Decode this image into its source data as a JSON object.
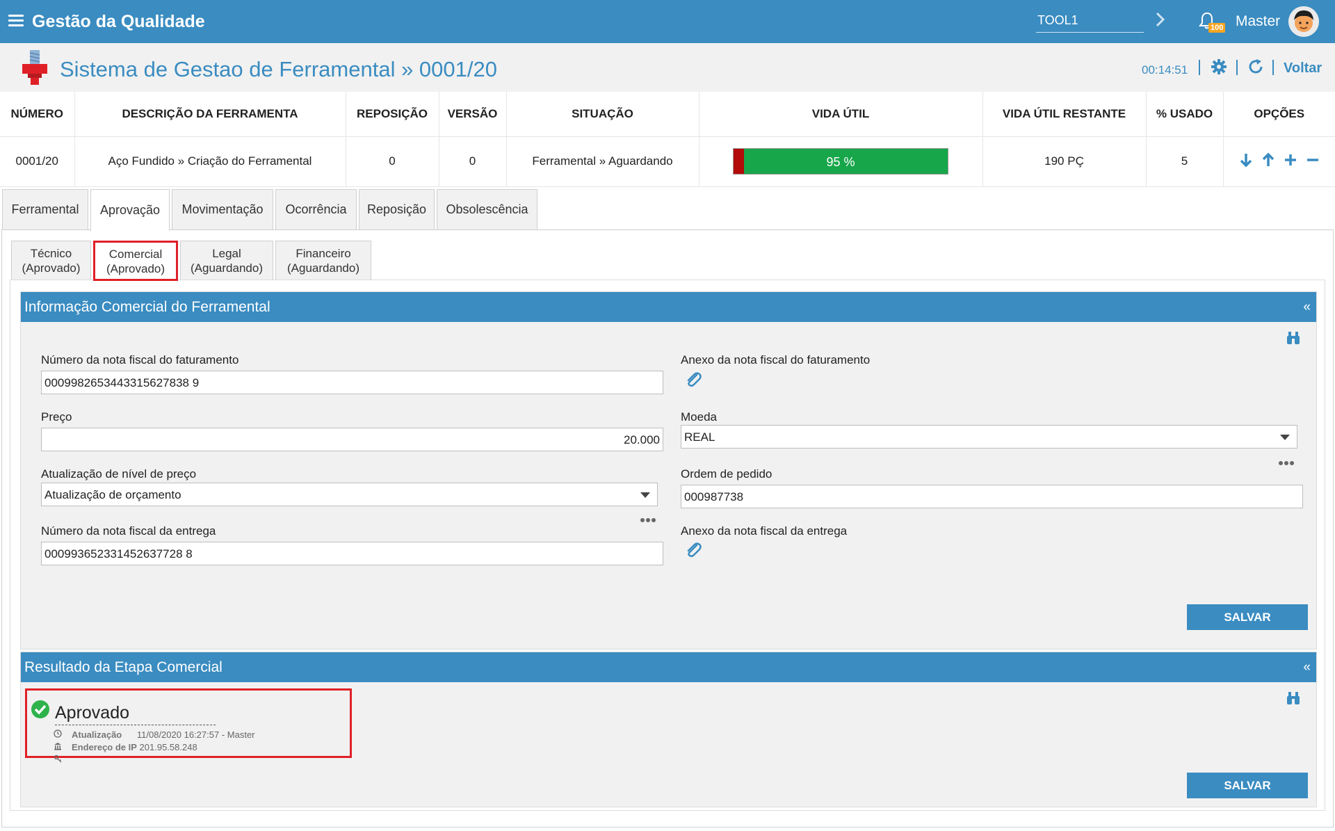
{
  "header": {
    "app_title": "Gestão da Qualidade",
    "tool_value": "TOOL1",
    "notification_count": "100",
    "username": "Master"
  },
  "title_bar": {
    "page_title": "Sistema de Gestao de Ferramental » 0001/20",
    "timer": "00:14:51",
    "back_label": "Voltar"
  },
  "summary": {
    "headers": [
      "NÚMERO",
      "DESCRIÇÃO DA FERRAMENTA",
      "REPOSIÇÃO",
      "VERSÃO",
      "SITUAÇÃO",
      "VIDA ÚTIL",
      "VIDA ÚTIL RESTANTE",
      "% USADO",
      "OPÇÕES"
    ],
    "row": {
      "numero": "0001/20",
      "descricao": "Aço Fundido » Criação do Ferramental",
      "reposicao": "0",
      "versao": "0",
      "situacao": "Ferramental » Aguardando",
      "vida_util_label": "95 %",
      "vida_util_fraction": 0.95,
      "vida_restante": "190 PÇ",
      "usado": "5"
    }
  },
  "tabs": [
    "Ferramental",
    "Aprovação",
    "Movimentação",
    "Ocorrência",
    "Reposição",
    "Obsolescência"
  ],
  "active_tab": "Aprovação",
  "subtabs": [
    {
      "line1": "Técnico",
      "line2": "(Aprovado)"
    },
    {
      "line1": "Comercial",
      "line2": "(Aprovado)"
    },
    {
      "line1": "Legal",
      "line2": "(Aguardando)"
    },
    {
      "line1": "Financeiro",
      "line2": "(Aguardando)"
    }
  ],
  "commercial_info": {
    "title": "Informação Comercial do Ferramental",
    "invoice_number_label": "Número da nota fiscal do faturamento",
    "invoice_number_value": "0009982653443315627838 9",
    "invoice_attachment_label": "Anexo da nota fiscal do faturamento",
    "price_label": "Preço",
    "price_value": "20.000",
    "currency_label": "Moeda",
    "currency_value": "REAL",
    "price_level_label": "Atualização de nível de preço",
    "price_level_value": "Atualização de orçamento",
    "order_label": "Ordem de pedido",
    "order_value": "000987738",
    "delivery_invoice_label": "Número da nota fiscal da entrega",
    "delivery_invoice_value": "000993652331452637728 8",
    "delivery_attachment_label": "Anexo da nota fiscal da entrega",
    "save_label": "SALVAR"
  },
  "commercial_result": {
    "title": "Resultado da Etapa Comercial",
    "status": "Aprovado",
    "update_label": "Atualização",
    "update_value": "11/08/2020 16:27:57",
    "update_user": "- Master",
    "ip_label": "Endereço de IP",
    "ip_value": "201.95.58.248",
    "save_label": "SALVAR"
  },
  "colors": {
    "primary": "#3a8cc1",
    "highlight": "#e02027",
    "life_green": "#17a64a",
    "life_red": "#b30a0a",
    "approved_green": "#2eb24b"
  }
}
